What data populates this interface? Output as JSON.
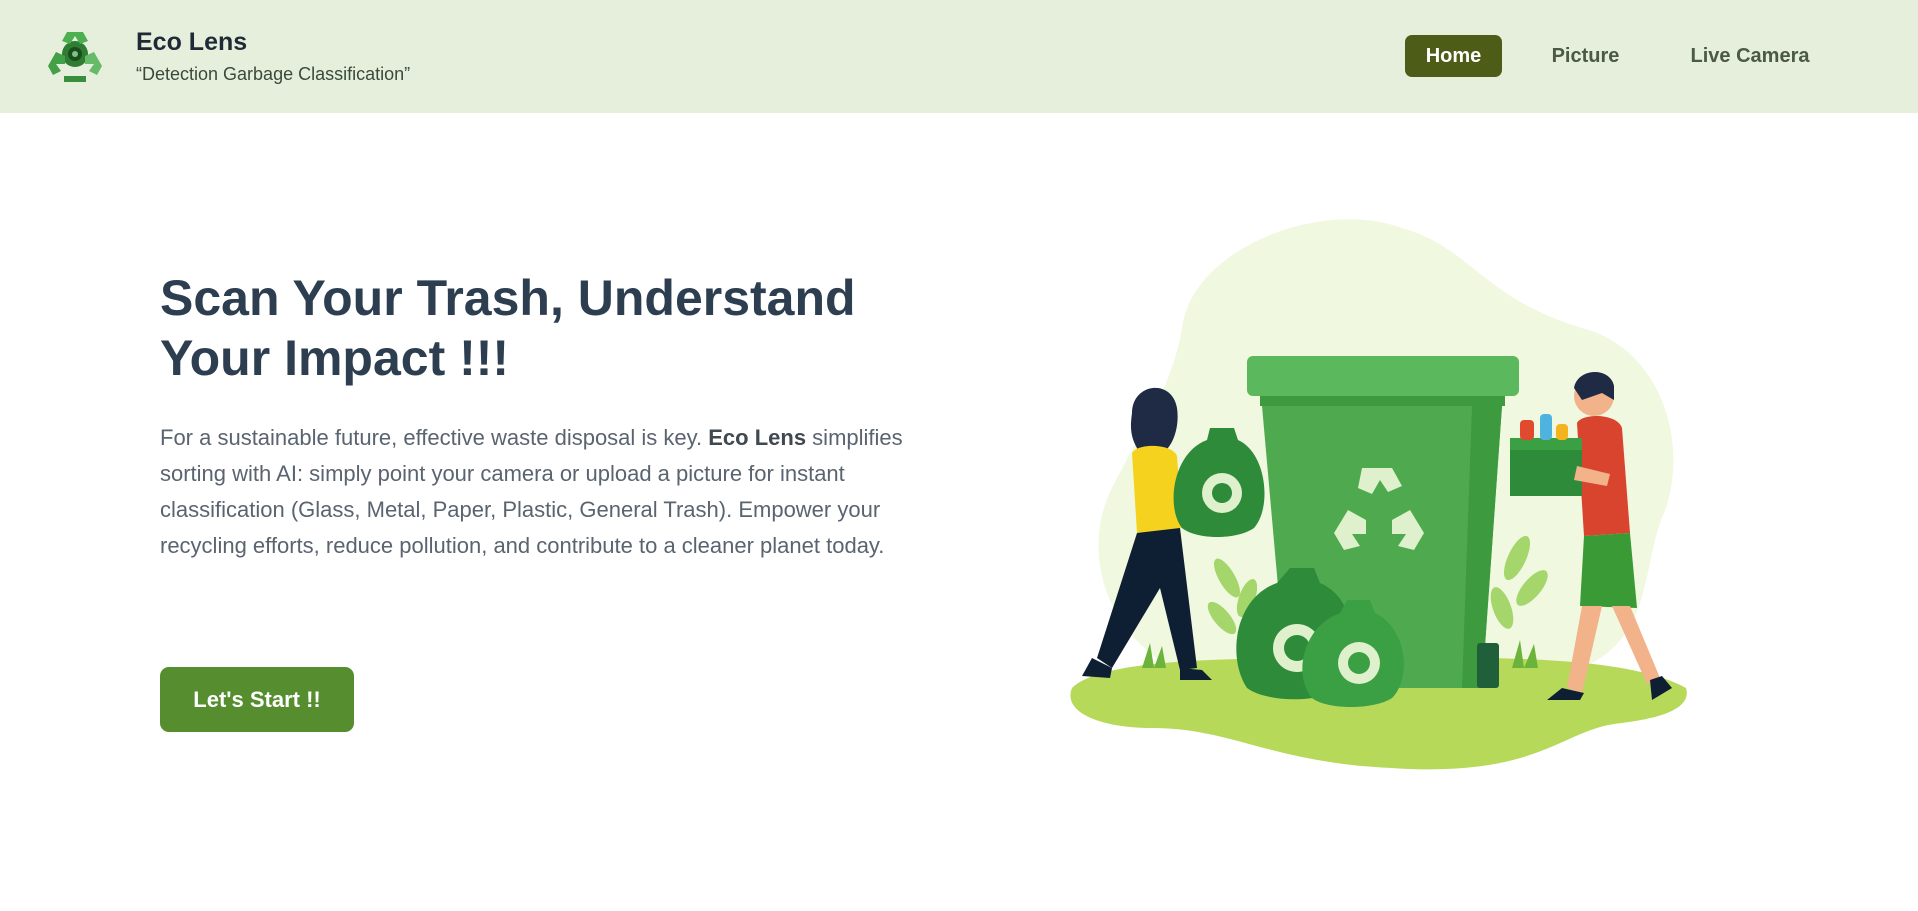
{
  "brand": {
    "name": "Eco Lens",
    "tagline": "“Detection Garbage Classification”",
    "logo_icon": "recycle-logo-icon"
  },
  "nav": {
    "items": [
      {
        "label": "Home",
        "active": true
      },
      {
        "label": "Picture",
        "active": false
      },
      {
        "label": "Live Camera",
        "active": false
      }
    ]
  },
  "hero": {
    "headline": "Scan Your Trash, Understand Your Impact !!!",
    "description_lead": "For a sustainable future, effective waste disposal is key. ",
    "description_brand": "Eco Lens",
    "description_rest": " simplifies sorting with AI: simply point your camera or upload a picture for instant classification (Glass, Metal, Paper, Plastic, General Trash). Empower your recycling efforts, reduce pollution, and contribute to a cleaner planet today.",
    "cta_label": "Let's Start !!"
  },
  "colors": {
    "navbar_bg": "#e6efdc",
    "nav_active_bg": "#4d5d17",
    "cta_bg": "#568d2e",
    "headline": "#2c3e50",
    "body_text": "#5a6470"
  },
  "illustration": {
    "icon": "recycling-illustration",
    "elements": [
      "recycle-bin",
      "woman-with-bag",
      "man-with-box",
      "garbage-bags",
      "recycle-symbol"
    ]
  }
}
